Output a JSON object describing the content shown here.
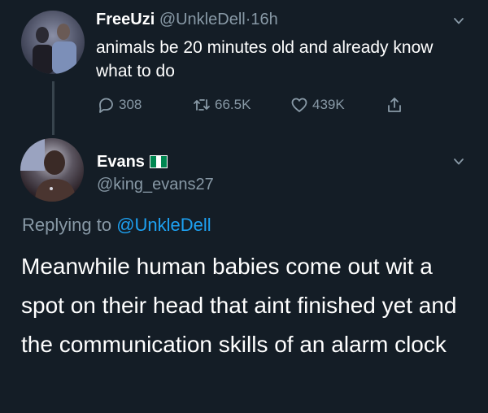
{
  "tweet": {
    "display_name": "FreeUzi",
    "handle": "@UnkleDell",
    "separator": "·",
    "time": "16h",
    "text": "animals be 20 minutes old and already know what to do",
    "actions": {
      "replies": "308",
      "retweets": "66.5K",
      "likes": "439K"
    }
  },
  "reply": {
    "display_name": "Evans",
    "handle": "@king_evans27",
    "flag_colors": [
      "#008751",
      "#ffffff",
      "#008751"
    ],
    "replying_label": "Replying to",
    "replying_handle": "@UnkleDell",
    "text": "Meanwhile human babies come out wit a spot on their head that aint finished yet and the communication skills of an alarm clock"
  },
  "icons": {
    "reply": "comment-icon",
    "retweet": "retweet-icon",
    "like": "heart-icon",
    "share": "share-icon",
    "more": "chevron-down-icon"
  },
  "colors": {
    "background": "#141d26",
    "text_primary": "#ffffff",
    "text_secondary": "#8899a6",
    "link": "#1da1f2",
    "thread_line": "#38444d"
  }
}
